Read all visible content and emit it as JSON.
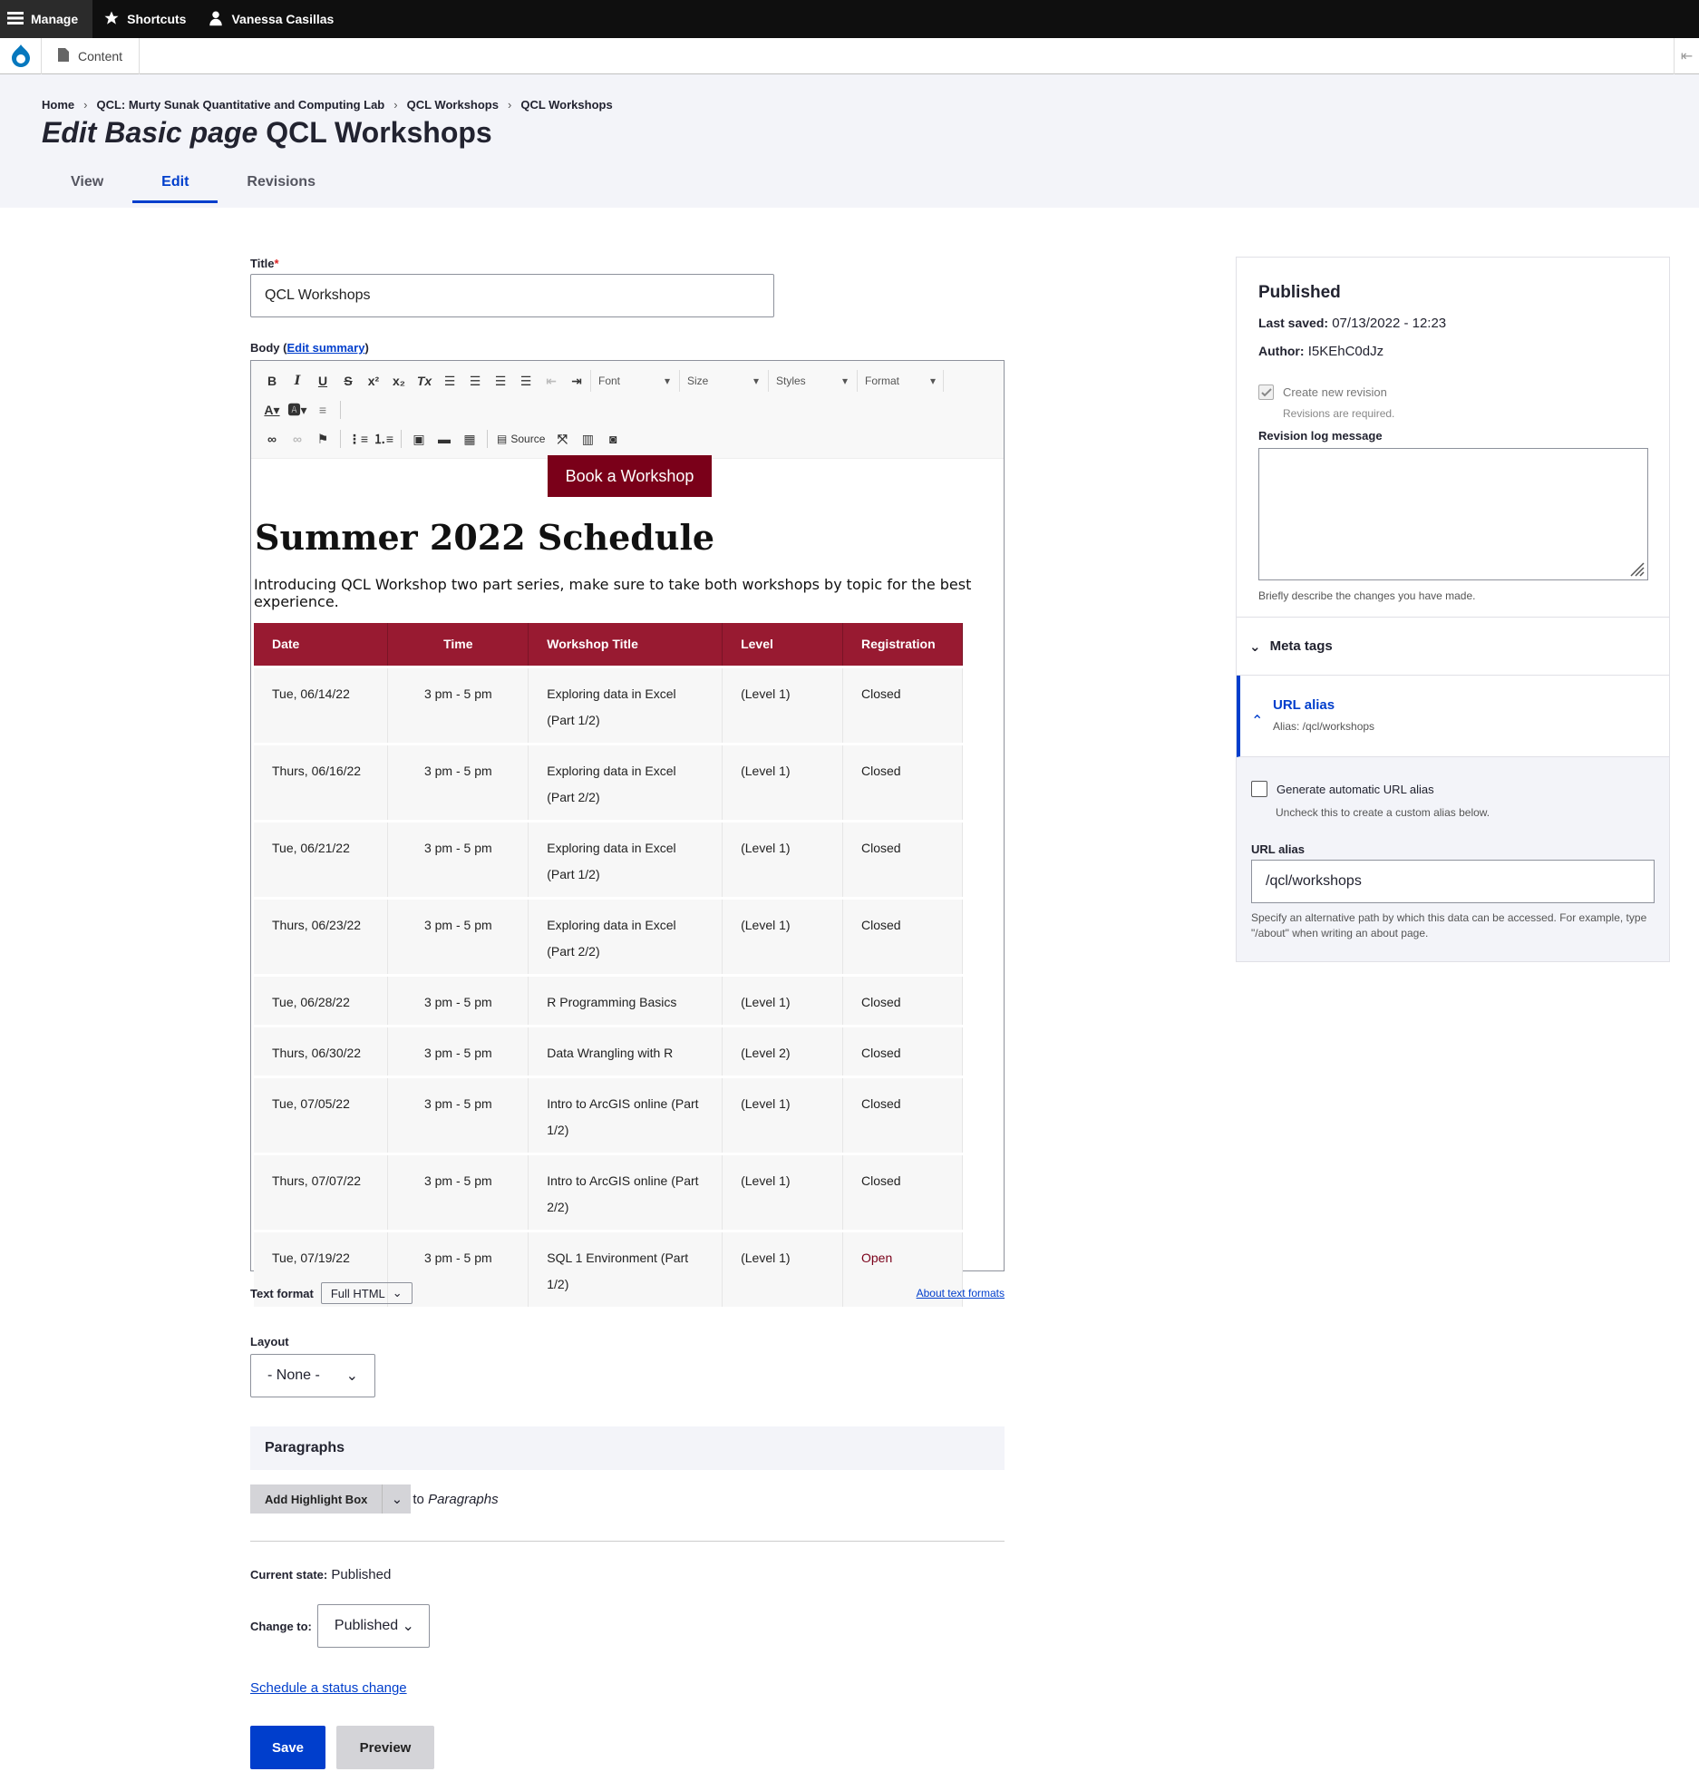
{
  "toolbar": {
    "manage": "Manage",
    "shortcuts": "Shortcuts",
    "user": "Vanessa Casillas",
    "content": "Content"
  },
  "breadcrumb": [
    "Home",
    "QCL: Murty Sunak Quantitative and Computing Lab",
    "QCL Workshops",
    "QCL Workshops"
  ],
  "page": {
    "title_em": "Edit Basic page",
    "title_rest": " QCL Workshops"
  },
  "tabs": [
    "View",
    "Edit",
    "Revisions"
  ],
  "form": {
    "title_label": "Title",
    "title_required_mark": "*",
    "title_value": "QCL Workshops",
    "body_label": "Body (",
    "body_link": "Edit summary",
    "body_label_close": ")",
    "text_format_label": "Text format",
    "text_format_value": "Full HTML",
    "about_text_formats": "About text formats",
    "layout_label": "Layout",
    "layout_value": "- None -",
    "paragraphs_title": "Paragraphs",
    "add_button": "Add Highlight Box",
    "add_suffix_to": "to ",
    "add_suffix_target": "Paragraphs",
    "current_state_label": "Current state:",
    "current_state_value": " Published",
    "change_to_label": "Change to:",
    "change_to_value": "Published",
    "schedule_link": "Schedule a status change",
    "save": "Save",
    "preview": "Preview"
  },
  "editor_toolbar": {
    "font": "Font",
    "size": "Size",
    "styles": "Styles",
    "format": "Format",
    "source": "Source"
  },
  "editor_content": {
    "book_button": "Book a Workshop",
    "heading": "Summer 2022 Schedule",
    "intro": "Introducing QCL Workshop two part series, make sure to take both workshops by topic for the best experience.",
    "columns": [
      "Date",
      "Time",
      "Workshop Title",
      "Level",
      "Registration"
    ],
    "rows": [
      [
        "Tue, 06/14/22",
        "3 pm - 5 pm",
        "Exploring data in Excel (Part 1/2)",
        "(Level 1)",
        "Closed"
      ],
      [
        "Thurs, 06/16/22",
        "3 pm - 5 pm",
        "Exploring data in Excel (Part 2/2)",
        "(Level 1)",
        "Closed"
      ],
      [
        "Tue, 06/21/22",
        "3 pm - 5 pm",
        "Exploring data in Excel (Part 1/2)",
        "(Level 1)",
        "Closed"
      ],
      [
        "Thurs, 06/23/22",
        "3 pm - 5 pm",
        "Exploring data in Excel (Part 2/2)",
        "(Level 1)",
        "Closed"
      ],
      [
        "Tue, 06/28/22",
        "3 pm - 5 pm",
        "R Programming Basics",
        "(Level 1)",
        "Closed"
      ],
      [
        "Thurs, 06/30/22",
        "3 pm - 5 pm",
        "Data Wrangling with R",
        "(Level 2)",
        "Closed"
      ],
      [
        "Tue, 07/05/22",
        "3 pm - 5 pm",
        "Intro to ArcGIS online (Part 1/2)",
        "(Level 1)",
        "Closed"
      ],
      [
        "Thurs, 07/07/22",
        "3 pm - 5 pm",
        "Intro to ArcGIS online (Part 2/2)",
        "(Level 1)",
        "Closed"
      ],
      [
        "Tue, 07/19/22",
        "3 pm - 5 pm",
        "SQL 1 Environment (Part 1/2)",
        "(Level 1)",
        "Open"
      ]
    ]
  },
  "sidebar": {
    "status": "Published",
    "last_saved_label": "Last saved:",
    "last_saved_value": " 07/13/2022 - 12:23",
    "author_label": "Author:",
    "author_value": " I5KEhC0dJz",
    "create_revision": "Create new revision",
    "revisions_required": "Revisions are required.",
    "revision_log_label": "Revision log message",
    "revision_log_desc": "Briefly describe the changes you have made.",
    "meta_tags": "Meta tags",
    "url_alias_title": "URL alias",
    "url_alias_summary": "Alias: /qcl/workshops",
    "generate_alias": "Generate automatic URL alias",
    "generate_alias_hint": "Uncheck this to create a custom alias below.",
    "url_alias_label": "URL alias",
    "url_alias_value": "/qcl/workshops",
    "url_alias_desc": "Specify an alternative path by which this data can be accessed. For example, type \"/about\" when writing an about page."
  },
  "colors": {
    "accent_blue": "#003ecc",
    "table_header": "#981a31",
    "book_button": "#7a0019",
    "open_status": "#7a0019"
  }
}
